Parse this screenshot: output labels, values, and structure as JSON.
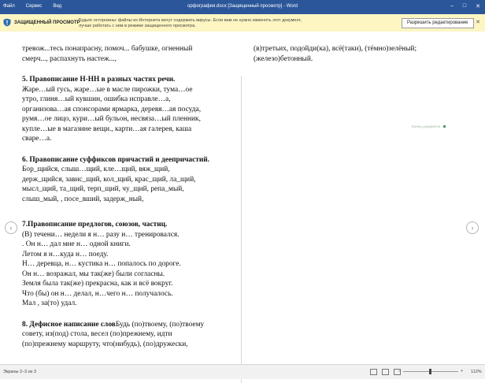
{
  "titlebar": {
    "menu": [
      "Файл",
      "Сервис",
      "Вид"
    ],
    "title": "орфография.docx [Защищенный просмотр] - Word"
  },
  "protected_view": {
    "title": "ЗАЩИЩЕННЫЙ ПРОСМОТР",
    "message": "Будьте осторожны: файлы из Интернета могут содержать вирусы. Если вам не нужно изменять этот документ, лучше работать с ним в режиме защищенного просмотра.",
    "button": "Разрешить редактирование"
  },
  "page_left": {
    "lines_top": [
      "тревож...тесь понапрасну, помоч... бабушке, огненный",
      "смерч..., распахнуть настеж...,"
    ],
    "section5": {
      "heading": "5. Правописание Н-НН в разных частях речи.",
      "lines": [
        "Жаре…ый гусь, жаре…ые в масле пирожки, тума…ое",
        "утро, глиня…ый кувшин, ошибка исправле…а,",
        "организова…ая спонсорами ярмарка, деревя…ая посуда,",
        "румя…ое лицо, кури…ый бульон, несвяза…ый пленник,",
        "купле…ые в магазине вещи., карти…ая галерея, каша",
        "сваре…а."
      ]
    },
    "section6": {
      "heading": "6. Правописание суффиксов причастий и деепричастий.",
      "lines": [
        "Бор_щийся, слыш…щий, кле…щий, вяж_щий,",
        "держ_щийся, завис_щий, кол_щий, крас_щий, ла_щий,",
        "мысл_щий, та_щий, терп_щий, чу_щий, репа_мый,",
        "слыш_мый, , посе_вший, задерж_ный,"
      ]
    },
    "section7": {
      "heading": "7.Правописание предлогов, союзов, частиц.",
      "lines": [
        " (В) течени… недели я н… разу н… тренировался.",
        ". Он н… дал мне н… одной книги.",
        "Летом я н…куда н… поеду.",
        "Н… деревца, н… кустика н… попалось по дороге.",
        " Он н… возражал, мы так(же) были согласны.",
        "Земля была так(же) прекрасна, как и всё вокруг.",
        " Что (бы) он н… делал, н…чего н… получалось.",
        "Мал , за(то) удал."
      ]
    },
    "section8": {
      "heading": "8. Дефисное написание слов",
      "lines": [
        "Будь (по)твоему, (по)твоему",
        "совету, из(под) стола, весел (по)прежнему, идти",
        "(по)прежнему маршруту, что(нибудь), (по)дружески,"
      ]
    }
  },
  "page_right": {
    "lines": [
      "(в)третьих, подойди(ка), всё(таки), (тёмно)зелёный;",
      "(железо)бетонный."
    ],
    "end_marker": "Конец документа"
  },
  "statusbar": {
    "pages": "Экраны 2–3 из 3",
    "zoom": "112%",
    "zoom_minus": "–",
    "zoom_plus": "+"
  },
  "icons": {
    "nav_left": "chevron-left-icon",
    "nav_right": "chevron-right-icon",
    "shield": "shield-icon"
  },
  "colors": {
    "titlebar": "#2b579a",
    "protected_bar": "#fdf6c3"
  }
}
